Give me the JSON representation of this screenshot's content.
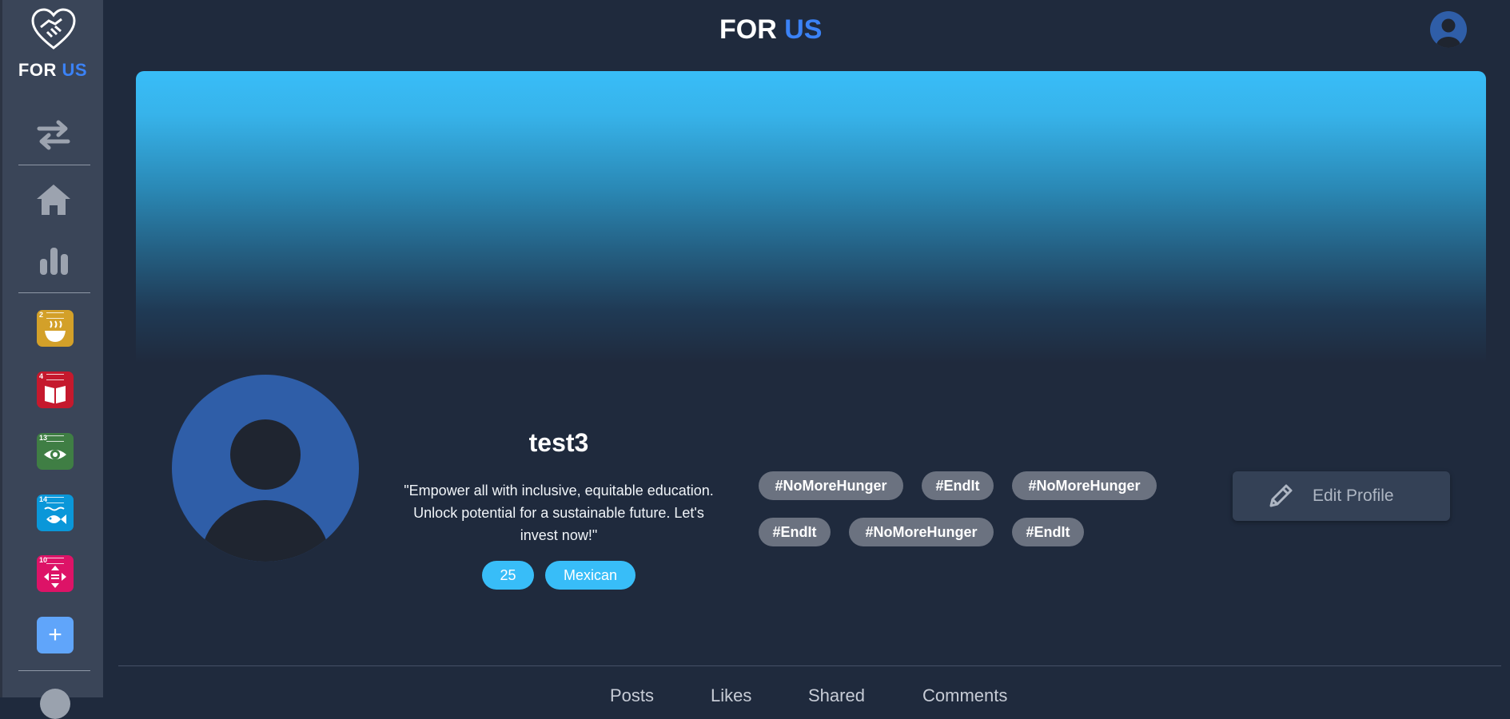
{
  "brand": {
    "name_part1": "FOR",
    "name_part2": "US"
  },
  "header": {
    "title_part1": "FOR",
    "title_part2": "US"
  },
  "sidebar": {
    "icons": [
      "swap-icon",
      "home-icon",
      "bar-chart-icon"
    ],
    "sdg_goals": [
      {
        "number": "2",
        "color": "#d3a029",
        "icon": "bowl-icon"
      },
      {
        "number": "4",
        "color": "#c5192d",
        "icon": "book-icon"
      },
      {
        "number": "13",
        "color": "#3f7e44",
        "icon": "eye-icon"
      },
      {
        "number": "14",
        "color": "#0a97d9",
        "icon": "fish-icon"
      },
      {
        "number": "10",
        "color": "#dd1367",
        "icon": "arrows-icon"
      }
    ],
    "add_label": "+"
  },
  "profile": {
    "username": "test3",
    "bio": "\"Empower all with inclusive, equitable education. Unlock potential for a sustainable future. Let's invest now!\"",
    "age": "25",
    "nationality": "Mexican",
    "tags": [
      "#NoMoreHunger",
      "#EndIt",
      "#NoMoreHunger",
      "#EndIt",
      "#NoMoreHunger",
      "#EndIt"
    ],
    "edit_label": "Edit Profile"
  },
  "tabs": [
    "Posts",
    "Likes",
    "Shared",
    "Comments"
  ],
  "colors": {
    "background": "#1f2a3d",
    "sidebar": "#3a4558",
    "accent": "#3b82f6",
    "pill": "#38bdf8",
    "tag": "#6b7280",
    "avatar": "#2f5ea8"
  }
}
